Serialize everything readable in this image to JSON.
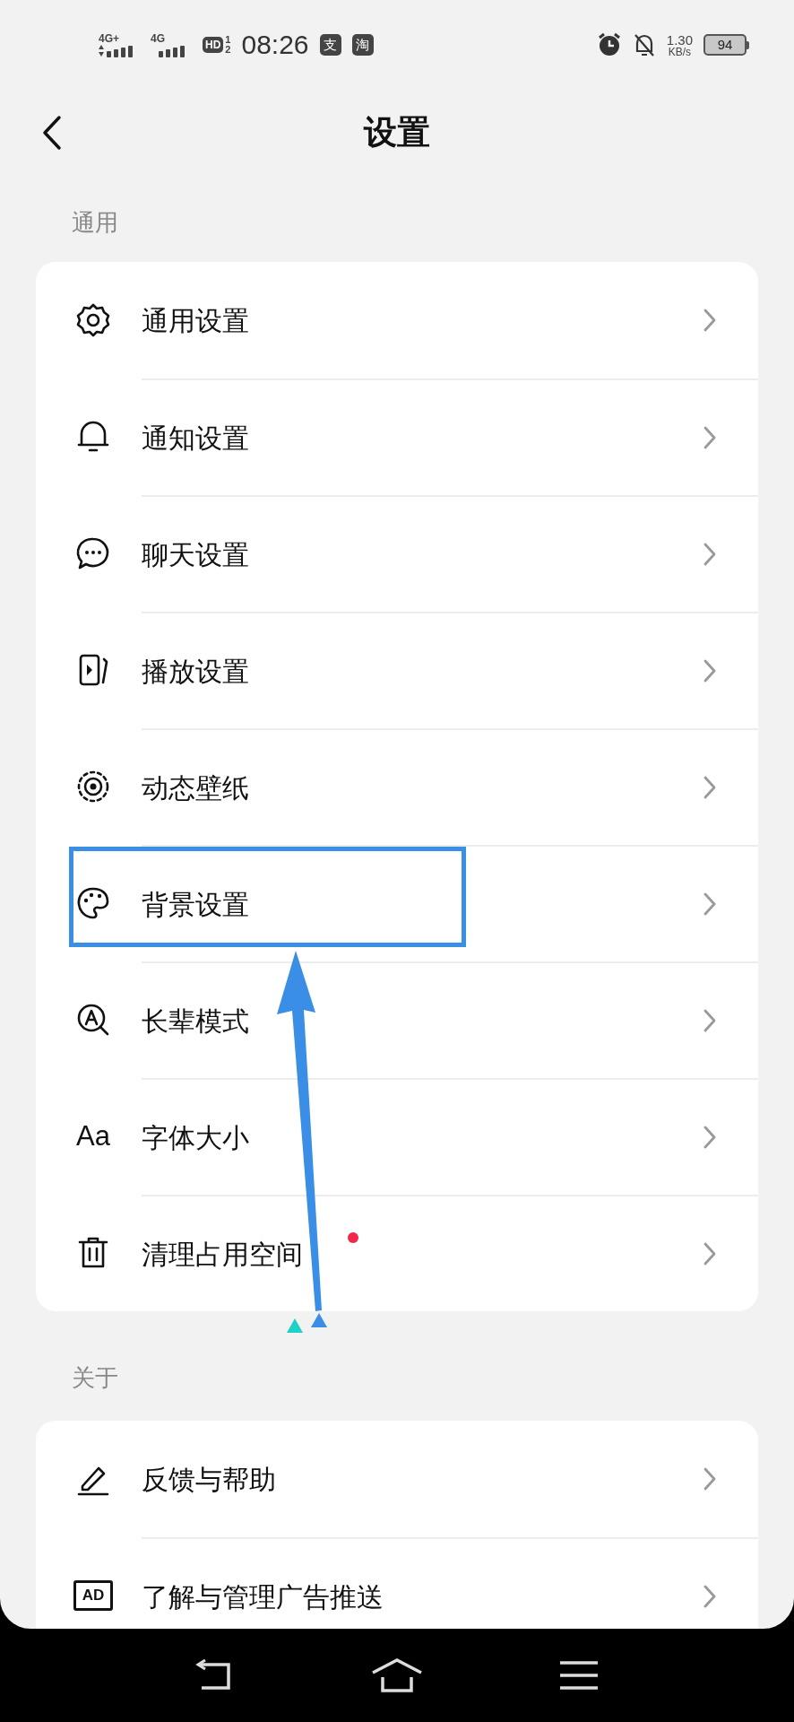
{
  "status_bar": {
    "network_1": "4G+",
    "network_2": "4G",
    "hd": "HD",
    "hd_sims": [
      "1",
      "2"
    ],
    "time": "08:26",
    "app_badges": [
      "支",
      "淘"
    ],
    "speed": "1.30",
    "speed_unit": "KB/s",
    "battery": "94"
  },
  "header": {
    "title": "设置"
  },
  "sections": [
    {
      "label": "通用",
      "items": [
        {
          "label": "通用设置",
          "new": false,
          "highlighted": false
        },
        {
          "label": "通知设置",
          "new": false,
          "highlighted": false
        },
        {
          "label": "聊天设置",
          "new": false,
          "highlighted": false
        },
        {
          "label": "播放设置",
          "new": false,
          "highlighted": false
        },
        {
          "label": "动态壁纸",
          "new": false,
          "highlighted": false
        },
        {
          "label": "背景设置",
          "new": false,
          "highlighted": true
        },
        {
          "label": "长辈模式",
          "new": false,
          "highlighted": false
        },
        {
          "label": "字体大小",
          "icon_text": "Aa",
          "new": false,
          "highlighted": false
        },
        {
          "label": "清理占用空间",
          "new": true,
          "highlighted": false
        }
      ]
    },
    {
      "label": "关于",
      "items": [
        {
          "label": "反馈与帮助",
          "new": false,
          "highlighted": false
        },
        {
          "label": "了解与管理广告推送",
          "icon_text": "AD",
          "new": false,
          "highlighted": false
        }
      ]
    }
  ]
}
